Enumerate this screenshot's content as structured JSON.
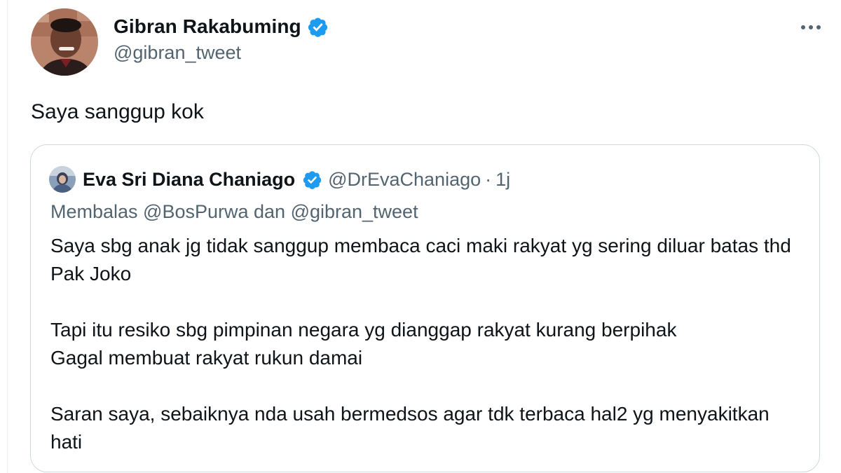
{
  "tweet": {
    "display_name": "Gibran Rakabuming",
    "handle": "@gibran_tweet",
    "text": "Saya sanggup kok",
    "verified_icon": "verified-badge-icon",
    "more_icon": "more-options-icon"
  },
  "quote": {
    "display_name": "Eva Sri Diana Chaniago",
    "handle": "@DrEvaChaniago",
    "separator": "·",
    "time": "1j",
    "reply_to": "Membalas @BosPurwa dan @gibran_tweet",
    "paragraphs": [
      "Saya sbg anak jg tidak sanggup membaca caci maki rakyat yg sering diluar batas thd Pak Joko",
      "Tapi itu resiko sbg pimpinan negara yg dianggap rakyat kurang berpihak\nGagal membuat rakyat rukun damai",
      "Saran saya, sebaiknya nda usah bermedsos agar tdk terbaca hal2 yg menyakitkan hati"
    ]
  },
  "colors": {
    "verified": "#1d9bf0",
    "secondary_text": "#536471",
    "border": "#cfd9de"
  }
}
